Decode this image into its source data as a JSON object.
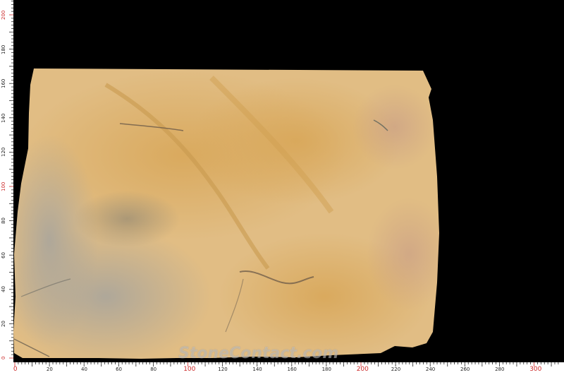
{
  "image": {
    "subject": "slab-photo",
    "colors": {
      "background": "#000000",
      "ruler_bg": "#ffffff",
      "major_tick": "#cc2a2a",
      "minor_tick": "#222222",
      "slab_base": "#e3bf86",
      "slab_warm": "#d9a85c",
      "slab_gray": "#b8b2a6",
      "vein_dark": "#6b5a48"
    }
  },
  "ruler_left": {
    "labels": [
      "0",
      "20",
      "40",
      "60",
      "80",
      "100",
      "120",
      "140",
      "160",
      "180",
      "200"
    ],
    "major_labels": [
      "0",
      "100",
      "200"
    ]
  },
  "ruler_bottom": {
    "labels": [
      "0",
      "20",
      "40",
      "60",
      "80",
      "100",
      "120",
      "140",
      "160",
      "180",
      "200",
      "220",
      "240",
      "260",
      "280",
      "300"
    ],
    "major_labels": [
      "0",
      "100",
      "200",
      "300"
    ]
  },
  "watermark": {
    "text": "StoneContact.com"
  }
}
